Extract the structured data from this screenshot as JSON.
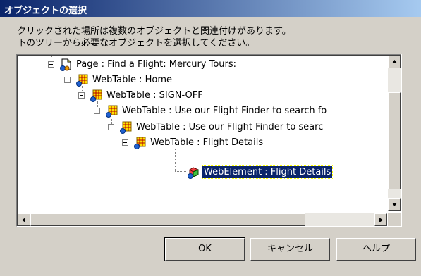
{
  "dialog": {
    "title": "オブジェクトの選択",
    "message_line1": "クリックされた場所は複数のオブジェクトと関連付けがあります。",
    "message_line2": "下のツリーから必要なオブジェクトを選択してください。"
  },
  "tree": {
    "nodes": [
      {
        "label": "Page : Find a Flight: Mercury Tours:",
        "icon": "page-icon"
      },
      {
        "label": "WebTable : Home",
        "icon": "webtable-icon"
      },
      {
        "label": "WebTable : SIGN-OFF",
        "icon": "webtable-icon"
      },
      {
        "label": "WebTable : Use our Flight Finder to search fo",
        "icon": "webtable-icon"
      },
      {
        "label": "WebTable : Use our Flight Finder to searc",
        "icon": "webtable-icon"
      },
      {
        "label": "WebTable :  Flight Details",
        "icon": "webtable-icon"
      },
      {
        "label": "WebElement : Flight Details",
        "icon": "webelement-icon",
        "selected": true
      }
    ]
  },
  "buttons": {
    "ok": "OK",
    "cancel": "キャンセル",
    "help": "ヘルプ"
  }
}
